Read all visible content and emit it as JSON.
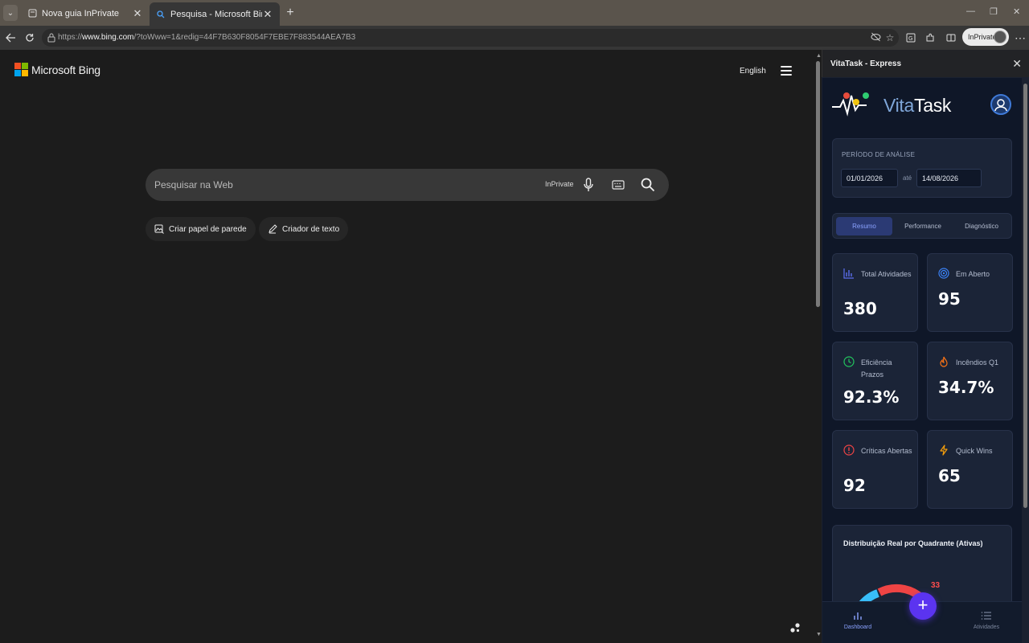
{
  "browser": {
    "tabs": [
      {
        "label": "Nova guia InPrivate",
        "active": false
      },
      {
        "label": "Pesquisa - Microsoft Bing",
        "active": true
      }
    ],
    "url_prefix": "https://",
    "url_host": "www.bing.com",
    "url_path": "/?toWww=1&redig=44F7B630F8054F7EBE7F883544AEA7B3",
    "inprivate_label": "InPrivate"
  },
  "bing": {
    "logo_text": "Microsoft Bing",
    "logo_colors": [
      "#f25022",
      "#7fba00",
      "#00a4ef",
      "#ffb900"
    ],
    "language": "English",
    "search_placeholder": "Pesquisar na Web",
    "search_tag": "InPrivate",
    "chips": [
      {
        "label": "Criar papel de parede",
        "icon": "wallpaper-icon"
      },
      {
        "label": "Criador de texto",
        "icon": "pen-icon"
      }
    ]
  },
  "panel": {
    "title": "VitaTask - Express",
    "app_name_prefix": "Vita",
    "app_name_suffix": "Task",
    "period": {
      "label": "PERÍODO DE ANÁLISE",
      "start": "01/01/2026",
      "separator": "até",
      "end": "14/08/2026"
    },
    "tabs": [
      {
        "label": "Resumo",
        "active": true
      },
      {
        "label": "Performance",
        "active": false
      },
      {
        "label": "Diagnóstico",
        "active": false
      }
    ],
    "kpis": [
      {
        "label": "Total Atividades",
        "value": "380",
        "icon": "bar-chart-icon",
        "color": "#5b6ef0"
      },
      {
        "label": "Em Aberto",
        "value": "95",
        "icon": "target-icon",
        "color": "#3b82f6"
      },
      {
        "label": "Eficiência Prazos",
        "value": "92.3%",
        "icon": "clock-icon",
        "color": "#22c55e"
      },
      {
        "label": "Incêndios Q1",
        "value": "34.7%",
        "icon": "flame-icon",
        "color": "#f97316"
      },
      {
        "label": "Críticas Abertas",
        "value": "92",
        "icon": "alert-icon",
        "color": "#ef4444"
      },
      {
        "label": "Quick Wins",
        "value": "65",
        "icon": "lightning-icon",
        "color": "#f59e0b"
      }
    ],
    "distribution": {
      "title": "Distribuição Real por Quadrante (Ativas)",
      "visible_value": "33"
    },
    "nav": [
      {
        "label": "Dashboard",
        "active": true
      },
      {
        "label": "Atividades",
        "active": false
      }
    ],
    "fab": "+"
  }
}
